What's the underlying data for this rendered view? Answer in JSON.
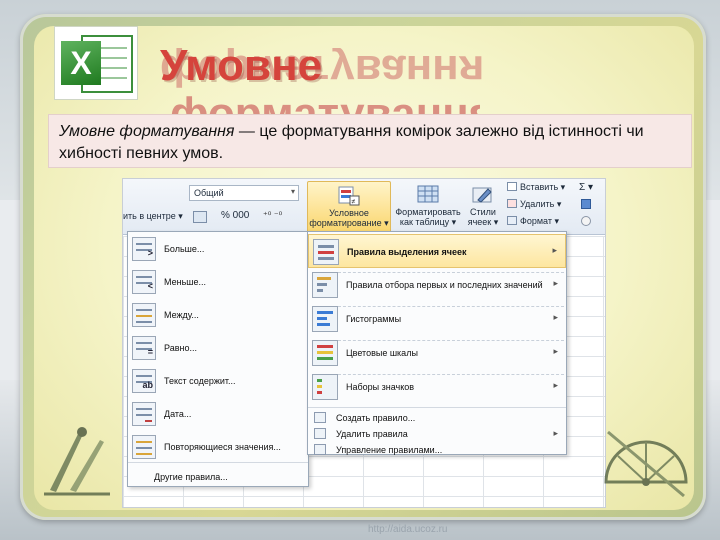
{
  "slide": {
    "title": "Умовне форматування",
    "title_line1": "Умовне",
    "title_line2": "форматування",
    "caption_term": "Умовне форматування",
    "caption_rest": " — це форматування комірок залежно від істинності чи хибності певних умов.",
    "watermark": "http://aida.ucoz.ru"
  },
  "ribbon": {
    "merge_label": "ить в центре ▾",
    "number_format": "Общий",
    "number_symbols": "% 000",
    "conditional_formatting": [
      "Условное",
      "форматирование ▾"
    ],
    "format_as_table": [
      "Форматировать",
      "как таблицу ▾"
    ],
    "cell_styles": [
      "Стили",
      "ячеек ▾"
    ],
    "insert": "Вставить ▾",
    "delete": "Удалить ▾",
    "format": "Формат ▾",
    "sum_symbol": "Σ ▾"
  },
  "menu_rules": {
    "items": [
      {
        "label": "Больше...",
        "glyph": ">"
      },
      {
        "label": "Меньше...",
        "glyph": "<"
      },
      {
        "label": "Между...",
        "glyph": ""
      },
      {
        "label": "Равно...",
        "glyph": "="
      },
      {
        "label": "Текст содержит...",
        "glyph": "ab"
      },
      {
        "label": "Дата...",
        "glyph": ""
      },
      {
        "label": "Повторяющиеся значения...",
        "glyph": ""
      }
    ],
    "other_rules": "Другие правила..."
  },
  "menu_main": {
    "items": [
      {
        "label": "Правила выделения ячеек",
        "arrow": "▸",
        "highlighted": true
      },
      {
        "label": "Правила отбора первых и последних значений",
        "arrow": "▸"
      },
      {
        "label": "Гистограммы",
        "arrow": "▸"
      },
      {
        "label": "Цветовые шкалы",
        "arrow": "▸"
      },
      {
        "label": "Наборы значков",
        "arrow": "▸"
      }
    ],
    "small_items": [
      {
        "label": "Создать правило...",
        "arrow": ""
      },
      {
        "label": "Удалить правила",
        "arrow": "▸"
      },
      {
        "label": "Управление правилами...",
        "arrow": ""
      }
    ]
  },
  "colors": {
    "title": "#d5443c",
    "highlight": "#fde6a0",
    "excel_green": "#1f7a1f"
  }
}
